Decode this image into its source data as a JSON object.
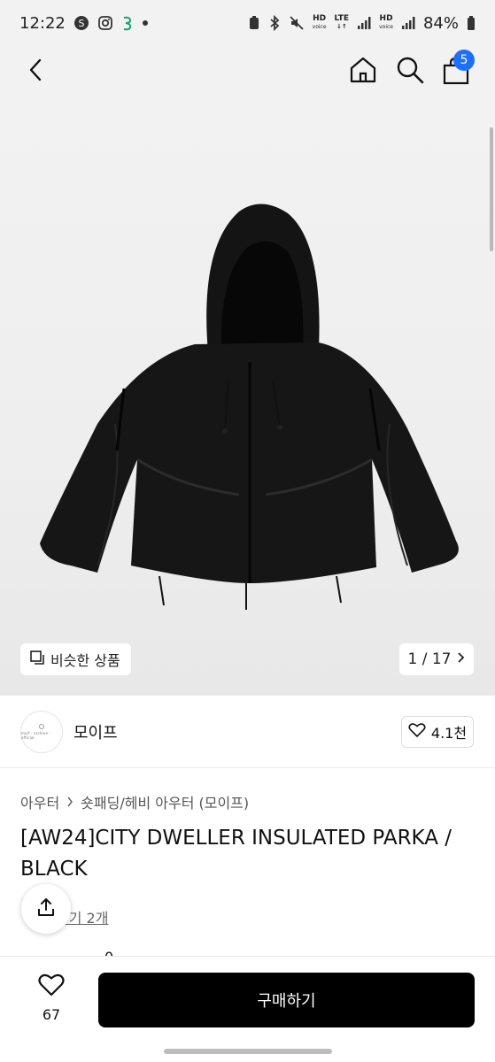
{
  "status_bar": {
    "time": "12:22",
    "network_1": "HD",
    "network_lte": "LTE",
    "network_2": "HD",
    "voice_label": "voice",
    "battery": "84%"
  },
  "nav": {
    "cart_count": "5"
  },
  "gallery": {
    "similar_label": "비슷한 상품",
    "page_indicator": "1 / 17"
  },
  "shop": {
    "name": "모이프",
    "likes": "4.1천",
    "avatar_text": "moif · archive · official"
  },
  "product": {
    "breadcrumb": [
      "아우터",
      "숏패딩/헤비 아우터 (모이프)"
    ],
    "title": "[AW24]CITY DWELLER INSULATED PARKA / BLACK",
    "review_link": "후기 2개",
    "partial_text": "0"
  },
  "bottom_bar": {
    "wish_count": "67",
    "buy_label": "구매하기"
  },
  "colors": {
    "accent_badge": "#1f6fff",
    "buy_button": "#000000"
  }
}
